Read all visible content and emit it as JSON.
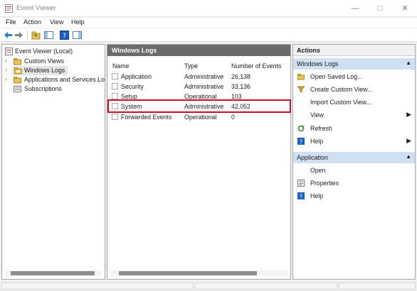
{
  "window": {
    "title": "Event Viewer"
  },
  "menu": [
    "File",
    "Action",
    "View",
    "Help"
  ],
  "tree": {
    "items": [
      {
        "label": "Event Viewer (Local)"
      },
      {
        "label": "Custom Views"
      },
      {
        "label": "Windows Logs"
      },
      {
        "label": "Applications and Services Logs"
      },
      {
        "label": "Subscriptions"
      }
    ]
  },
  "center": {
    "header": "Windows Logs",
    "columns": [
      "Name",
      "Type",
      "Number of Events"
    ],
    "rows": [
      {
        "name": "Application",
        "type": "Administrative",
        "count": "26,138"
      },
      {
        "name": "Security",
        "type": "Administrative",
        "count": "33,136"
      },
      {
        "name": "Setup",
        "type": "Operational",
        "count": "103"
      },
      {
        "name": "System",
        "type": "Administrative",
        "count": "42,052"
      },
      {
        "name": "Forwarded Events",
        "type": "Operational",
        "count": "0"
      }
    ]
  },
  "actions": {
    "title": "Actions",
    "section1": "Windows Logs",
    "items1": [
      "Open Saved Log...",
      "Create Custom View...",
      "Import Custom View...",
      "View",
      "Refresh",
      "Help"
    ],
    "section2": "Application",
    "items2": [
      "Open",
      "Properties",
      "Help"
    ]
  }
}
